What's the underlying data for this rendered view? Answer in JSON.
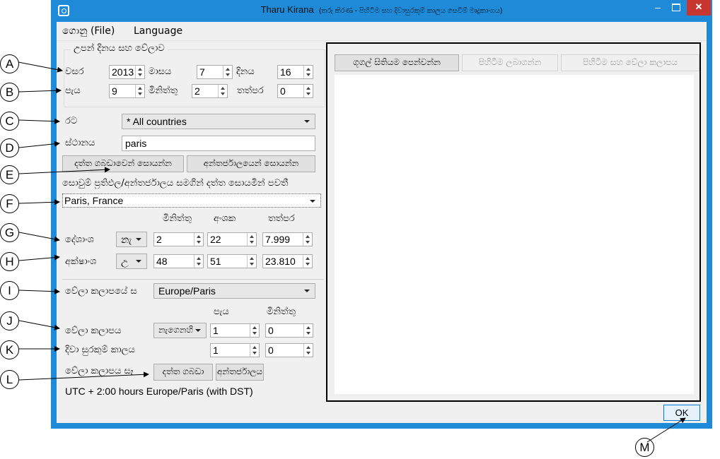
{
  "window": {
    "title": "Tharu Kirana",
    "subtitle": "(තරු කිරණ - පිහිටීම සහ දිවාසුරකුම් කාලය සෙවීම් මෘදුකාංගය)",
    "min_label": "–",
    "close_label": "✕"
  },
  "menu": {
    "file": "ගොනු (File)",
    "language": "Language"
  },
  "birth": {
    "group_title": "උපන් දිනය සහ වේලාව",
    "year_label": "වසර",
    "year": "2013",
    "month_label": "මාසය",
    "month": "7",
    "day_label": "දිනය",
    "day": "16",
    "hour_label": "පැය",
    "hour": "9",
    "minute_label": "මිනිත්තු",
    "minute": "2",
    "second_label": "තත්පර",
    "second": "0"
  },
  "location": {
    "country_label": "රට",
    "country": "* All countries",
    "place_label": "ස්ථානය",
    "place": "paris",
    "search_db_button": "දත්ත ගබඩාවෙන් සොයන්න",
    "search_web_button": "අන්තර්ජාලයෙන් සොයන්න",
    "status": "සොවුම් ප්‍රතිඵල/අන්තර්ජාලය සමගින් දත්ත සොයමින් පවතී",
    "result": "Paris, France",
    "hdr_min": "මිනිත්තු",
    "hdr_deg": "අංශක",
    "hdr_sec": "තත්පර",
    "lon_label": "දේශාංශ",
    "lon_dir": "නැ",
    "lon_min": "2",
    "lon_deg": "22",
    "lon_sec": "7.999",
    "lat_label": "අක්ෂාංශ",
    "lat_dir": "උ",
    "lat_min": "48",
    "lat_deg": "51",
    "lat_sec": "23.810"
  },
  "timezone": {
    "zone_label": "වේලා කලාපයේ ස",
    "zone": "Europe/Paris",
    "hdr_hour": "පැය",
    "hdr_min": "මිනිත්තු",
    "offset_label": "වේලා කලාපය",
    "offset_dir": "නැගෙනහි",
    "offset_hour": "1",
    "offset_min": "0",
    "dst_label": "දිවා සුරකුම් කාලය",
    "dst_hour": "1",
    "dst_min": "0",
    "tz_search_label": "වේලා කලාපය සෑ",
    "tz_db_button": "දත්ත ගබඩා",
    "tz_web_button": "අන්තර්ජාලය",
    "summary": "UTC + 2:00 hours Europe/Paris (with DST)"
  },
  "tabs": {
    "google_map": "ගූගල් සිතියම පෙන්වන්න",
    "get_location": "පිහිටීම ලබාගන්න",
    "location_zone": "පිහිටීම සහ වේලා කලාපය"
  },
  "ok_label": "OK",
  "callouts": [
    "A",
    "B",
    "C",
    "D",
    "E",
    "F",
    "G",
    "H",
    "I",
    "J",
    "K",
    "L",
    "M"
  ]
}
